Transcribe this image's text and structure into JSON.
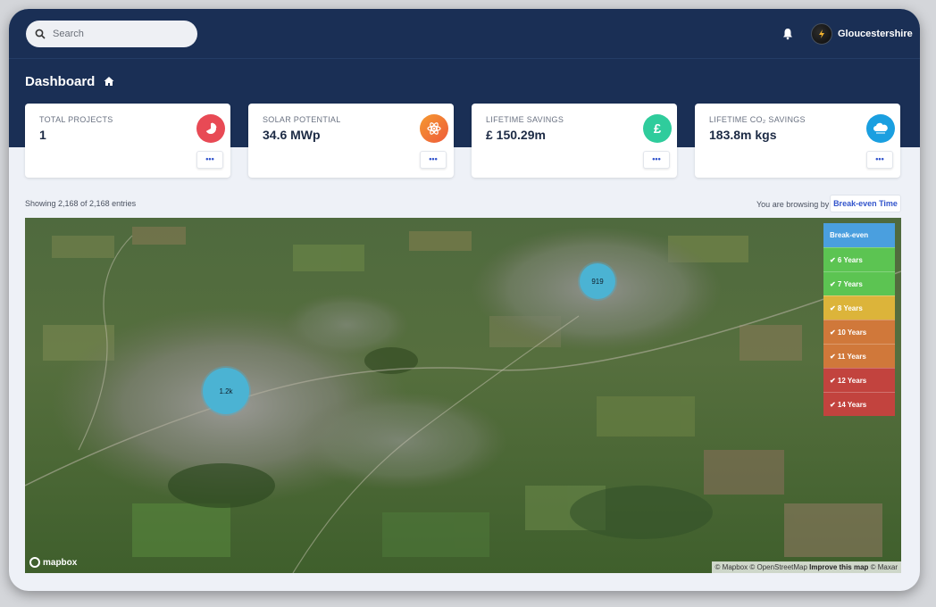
{
  "header": {
    "search_placeholder": "Search",
    "user_name": "Gloucestershire"
  },
  "page": {
    "title": "Dashboard"
  },
  "cards": [
    {
      "label": "TOTAL PROJECTS",
      "value": "1",
      "icon": "pie-chart-icon",
      "color": "#e84a55",
      "more": "•••"
    },
    {
      "label": "SOLAR POTENTIAL",
      "value": "34.6 MWp",
      "icon": "atom-icon",
      "color": "#f2822e",
      "more": "•••"
    },
    {
      "label": "LIFETIME SAVINGS",
      "value": "£ 150.29m",
      "icon": "pound-icon",
      "color": "#2fcc9c",
      "more": "•••",
      "icon_text": "£"
    },
    {
      "label": "LIFETIME CO₂ SAVINGS",
      "value": "183.8m kgs",
      "icon": "cloud-icon",
      "color": "#1a9fe0",
      "more": "•••"
    }
  ],
  "table": {
    "entries_text": "Showing 2,168 of 2,168 entries",
    "browsing_label": "You are browsing by",
    "browsing_value": "Break-even Time"
  },
  "map": {
    "clusters": [
      {
        "label": "1.2k"
      },
      {
        "label": "919"
      }
    ],
    "legend": {
      "header": "Break-even",
      "items": [
        {
          "label": "✔ 6 Years",
          "color": "#5cc452"
        },
        {
          "label": "✔ 7 Years",
          "color": "#5cc452"
        },
        {
          "label": "✔ 8 Years",
          "color": "#dcb43a"
        },
        {
          "label": "✔ 10 Years",
          "color": "#d0783a"
        },
        {
          "label": "✔ 11 Years",
          "color": "#d0783a"
        },
        {
          "label": "✔ 12 Years",
          "color": "#c2433e"
        },
        {
          "label": "✔ 14 Years",
          "color": "#c2433e"
        }
      ]
    },
    "logo_text": "mapbox",
    "attribution": {
      "part1": "© Mapbox © OpenStreetMap ",
      "improve": "Improve this map",
      "part2": " © Maxar"
    }
  }
}
